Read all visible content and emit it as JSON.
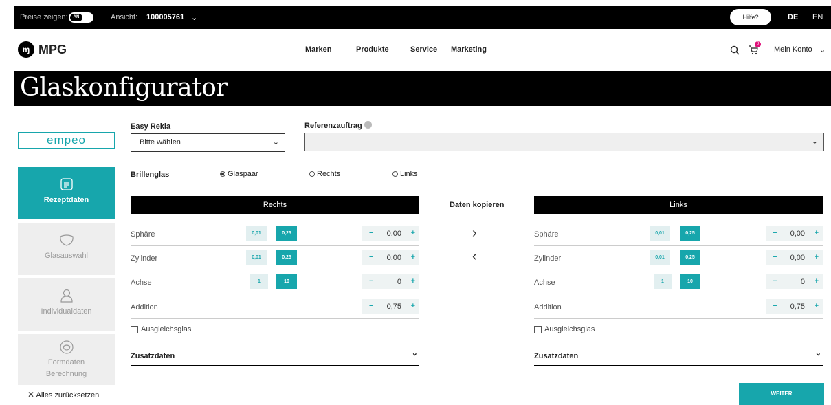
{
  "topbar": {
    "prices_label": "Preise zeigen:",
    "toggle_state": "AN",
    "view_label": "Ansicht:",
    "view_value": "100005761",
    "help_label": "Hilfe?",
    "lang_de": "DE",
    "lang_sep": "|",
    "lang_en": "EN"
  },
  "nav": {
    "logo_mark": "ɱ",
    "logo_text": "MPG",
    "links": [
      "Marken",
      "Produkte",
      "Service",
      "Marketing"
    ],
    "cart_count": "0",
    "account": "Mein Konto"
  },
  "page_title": "Glaskonfigurator",
  "sidebar": {
    "brand": "empeo",
    "items": [
      {
        "label": "Rezeptdaten",
        "active": true
      },
      {
        "label": "Glasauswahl",
        "active": false
      },
      {
        "label": "Individualdaten",
        "active": false
      },
      {
        "label": "Formdaten Berechnung",
        "active": false
      }
    ],
    "reset_label": "Alles zurücksetzen"
  },
  "form": {
    "easy_rekla_label": "Easy Rekla",
    "easy_rekla_value": "Bitte wählen",
    "referenz_label": "Referenzauftrag",
    "referenz_value": "",
    "brillenglas_label": "Brillenglas",
    "radio_options": [
      "Glaspaar",
      "Rechts",
      "Links"
    ],
    "radio_selected": "Glaspaar"
  },
  "panels": {
    "right": {
      "title": "Rechts",
      "rows": [
        {
          "name": "Sphäre",
          "steps": [
            "0,01",
            "0,25"
          ],
          "value": "0,00"
        },
        {
          "name": "Zylinder",
          "steps": [
            "0,01",
            "0,25"
          ],
          "value": "0,00"
        },
        {
          "name": "Achse",
          "steps": [
            "1",
            "10"
          ],
          "value": "0"
        },
        {
          "name": "Addition",
          "steps": [],
          "value": "0,75"
        }
      ],
      "ausgleich_label": "Ausgleichsglas",
      "zusatz_label": "Zusatzdaten"
    },
    "left": {
      "title": "Links",
      "rows": [
        {
          "name": "Sphäre",
          "steps": [
            "0,01",
            "0,25"
          ],
          "value": "0,00"
        },
        {
          "name": "Zylinder",
          "steps": [
            "0,01",
            "0,25"
          ],
          "value": "0,00"
        },
        {
          "name": "Achse",
          "steps": [
            "1",
            "10"
          ],
          "value": "0"
        },
        {
          "name": "Addition",
          "steps": [],
          "value": "0,75"
        }
      ],
      "ausgleich_label": "Ausgleichsglas",
      "zusatz_label": "Zusatzdaten"
    }
  },
  "copy_label": "Daten kopieren",
  "minus_symbol": "−",
  "plus_symbol": "+",
  "chevron_symbol": "⌄",
  "next_button": "WEITER",
  "colors": {
    "accent": "#17a6ac",
    "badge": "#e0107a"
  }
}
